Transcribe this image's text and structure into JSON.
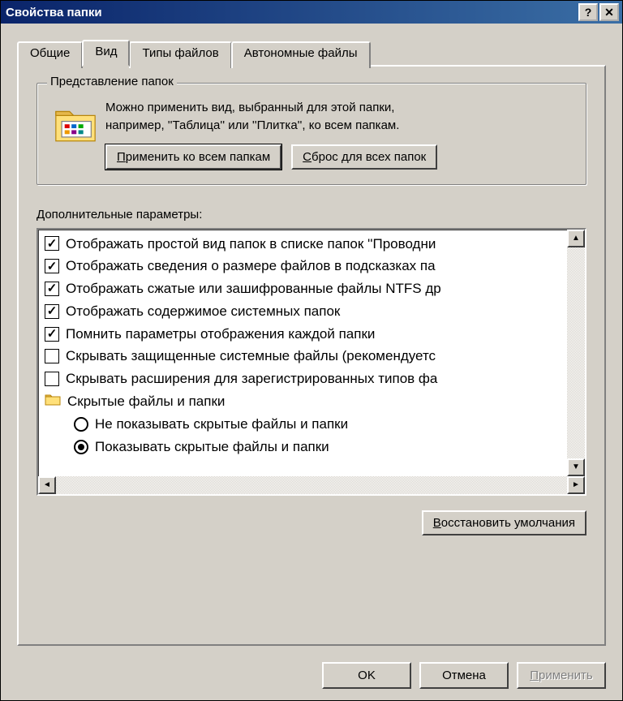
{
  "titlebar": {
    "title": "Свойства папки",
    "help": "?",
    "close": "✕"
  },
  "tabs": {
    "general": "Общие",
    "view": "Вид",
    "filetypes": "Типы файлов",
    "offline": "Автономные файлы"
  },
  "group": {
    "legend": "Представление папок",
    "line1": "Можно применить вид, выбранный для этой папки,",
    "line2": "например, ''Таблица'' или ''Плитка'', ко всем папкам.",
    "apply_all_pre": "Применить ко всем папкам",
    "reset_all": "Сброс для всех папок"
  },
  "additional_label": "Дополнительные параметры:",
  "tree": {
    "items": [
      {
        "type": "check",
        "checked": true,
        "label": "Отображать простой вид папок в списке папок ''Проводни"
      },
      {
        "type": "check",
        "checked": true,
        "label": "Отображать сведения о размере файлов в подсказках па"
      },
      {
        "type": "check",
        "checked": true,
        "label": "Отображать сжатые или зашифрованные файлы NTFS др"
      },
      {
        "type": "check",
        "checked": true,
        "label": "Отображать содержимое системных папок"
      },
      {
        "type": "check",
        "checked": true,
        "label": "Помнить параметры отображения каждой папки"
      },
      {
        "type": "check",
        "checked": false,
        "label": "Скрывать защищенные системные файлы (рекомендуетс"
      },
      {
        "type": "check",
        "checked": false,
        "label": "Скрывать расширения для зарегистрированных типов фа"
      },
      {
        "type": "folder",
        "label": "Скрытые файлы и папки"
      },
      {
        "type": "radio",
        "checked": false,
        "indent": true,
        "label": "Не показывать скрытые файлы и папки"
      },
      {
        "type": "radio",
        "checked": true,
        "indent": true,
        "label": "Показывать скрытые файлы и папки"
      }
    ]
  },
  "restore_defaults": "Восстановить умолчания",
  "footer": {
    "ok": "OK",
    "cancel": "Отмена",
    "apply": "Применить"
  }
}
